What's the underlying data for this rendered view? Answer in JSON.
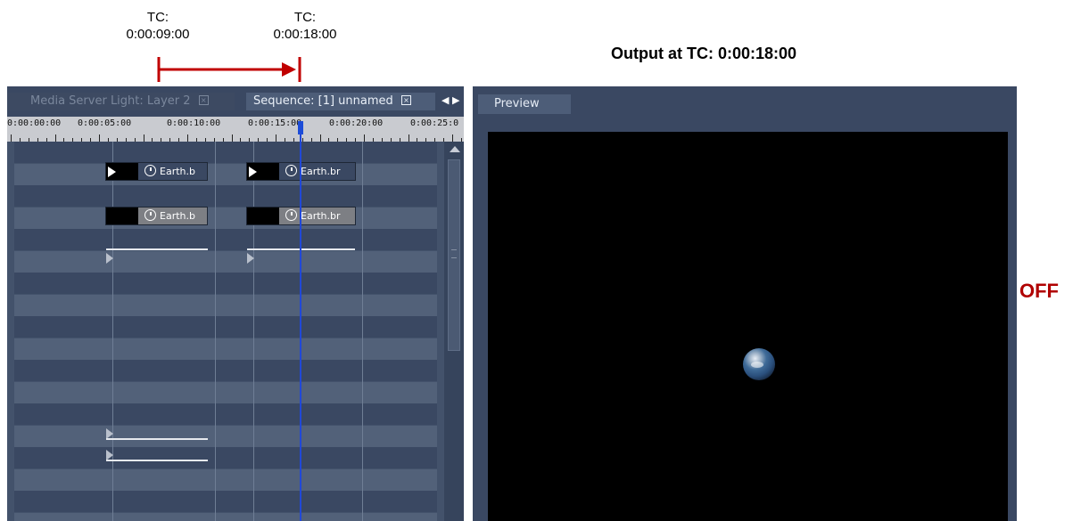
{
  "annotation": {
    "tc_start": {
      "label": "TC:",
      "value": "0:00:09:00"
    },
    "tc_end": {
      "label": "TC:",
      "value": "0:00:18:00"
    },
    "output": "Output at TC: 0:00:18:00",
    "status": "OFF",
    "arrow_color": "#c00000"
  },
  "left_panel": {
    "tabs": [
      {
        "label": "Media Server Light: Layer 2"
      },
      {
        "label": "Sequence: [1] unnamed"
      }
    ],
    "ruler": {
      "labels": [
        "0:00:00:00",
        "0:00:05:00",
        "0:00:10:00",
        "0:00:15:00",
        "0:00:20:00",
        "0:00:25:0"
      ],
      "playhead_tc": "0:00:18:00"
    },
    "clips": [
      {
        "name": "Earth.b"
      },
      {
        "name": "Earth.br"
      },
      {
        "name": "Earth.b"
      },
      {
        "name": "Earth.br"
      }
    ]
  },
  "right_panel": {
    "tab": "Preview",
    "preview_bg": "#000000"
  },
  "colors": {
    "panel_bg": "#43526b",
    "stripe_dark": "#3a4862",
    "stripe_light": "#526179",
    "playhead": "#2048d8",
    "annotation_red": "#c00000"
  }
}
